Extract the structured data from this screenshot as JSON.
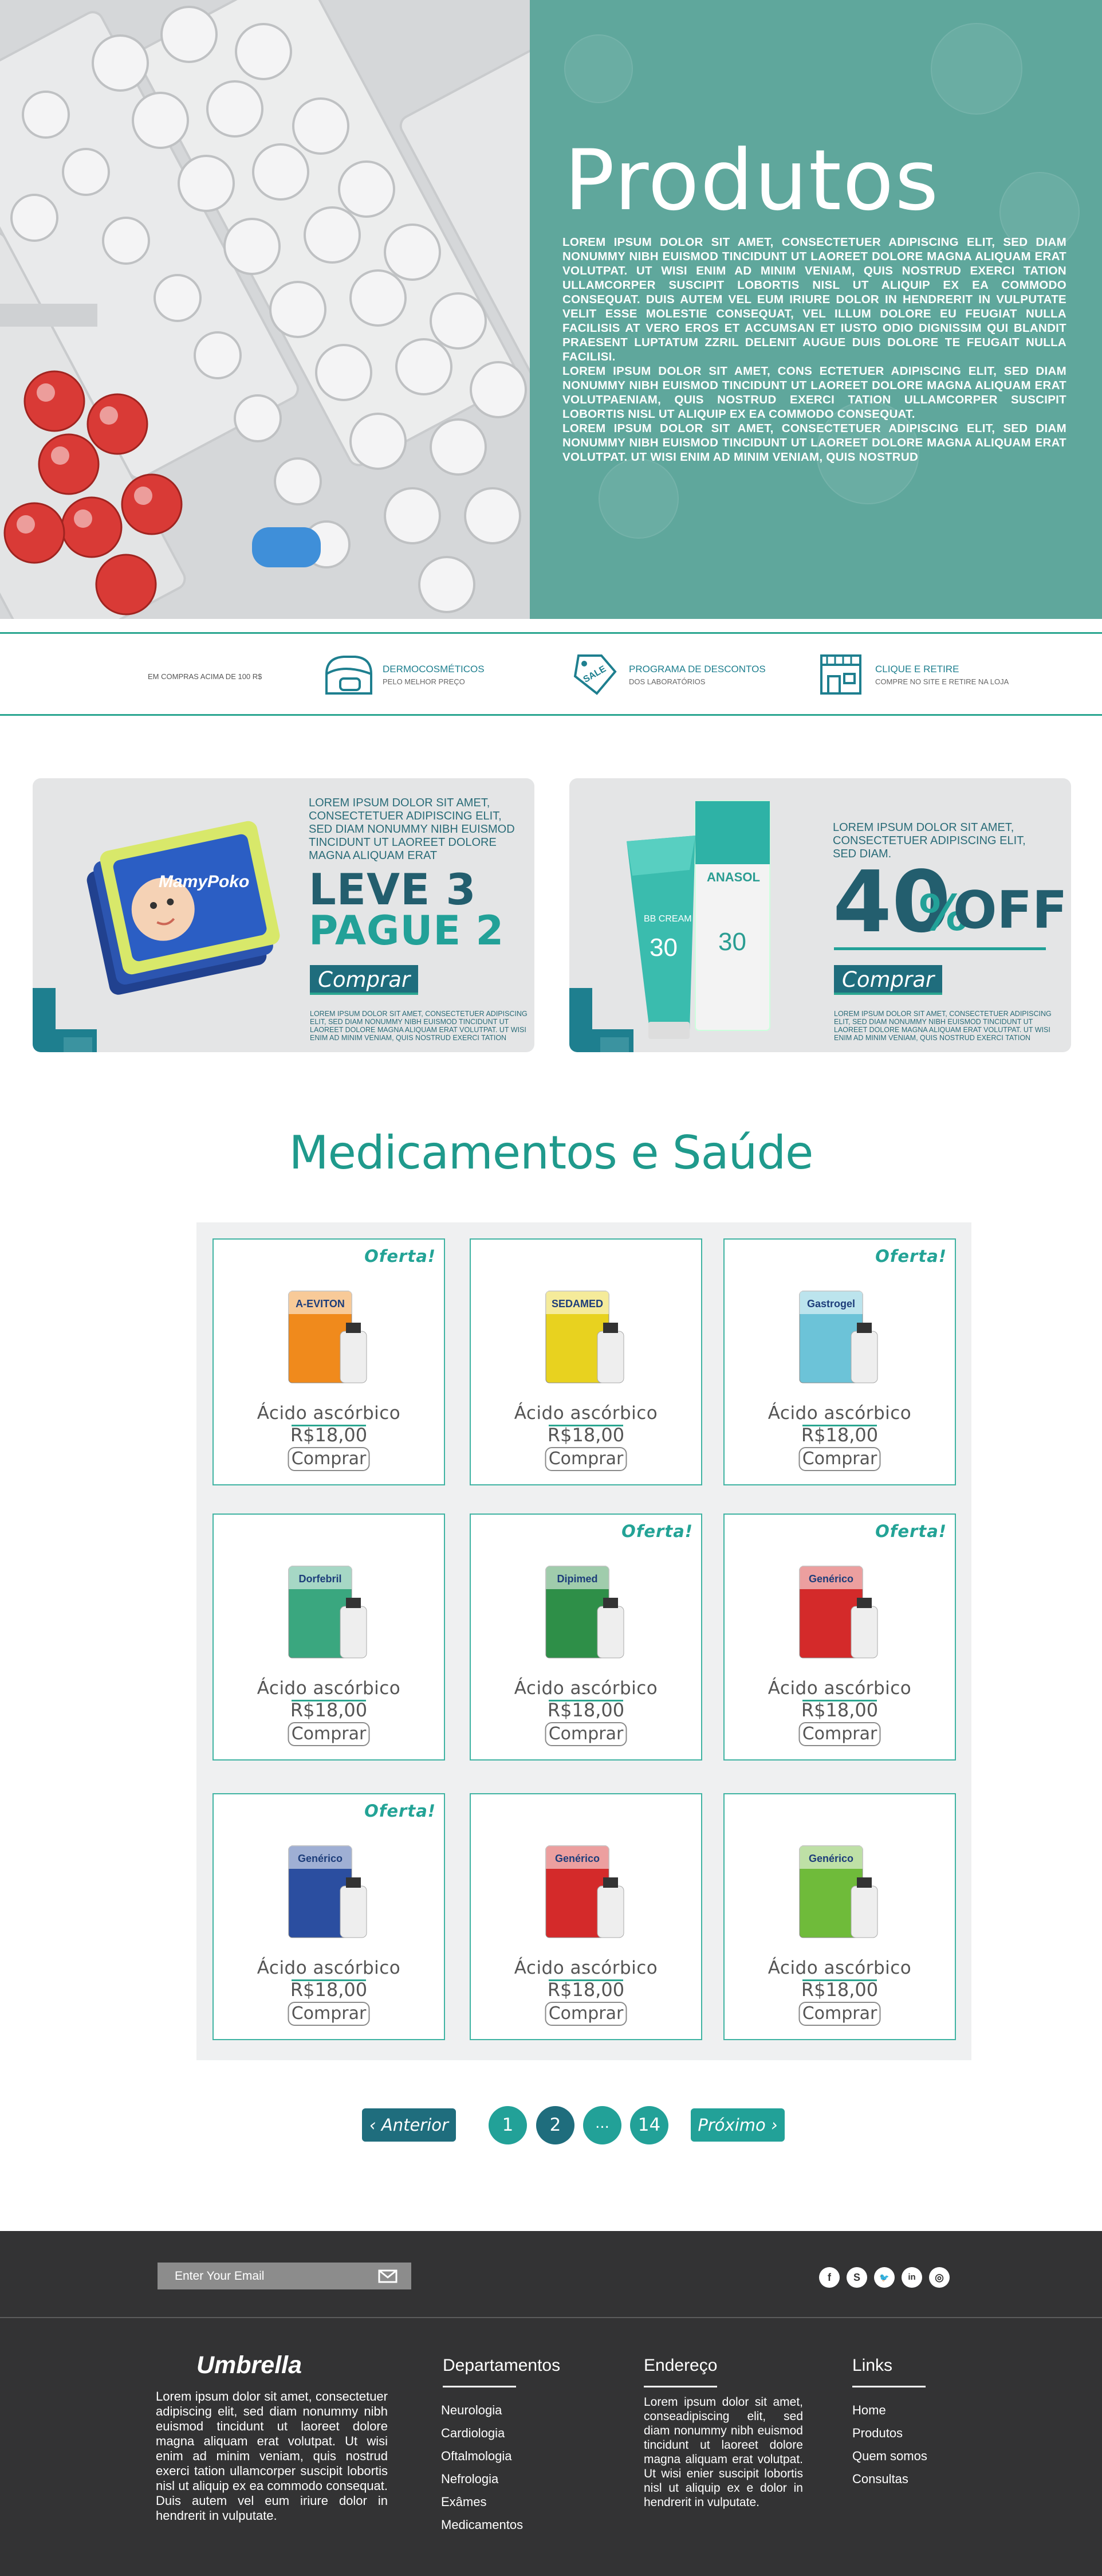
{
  "hero": {
    "title": "Produtos",
    "paragraphs": [
      "Lorem ipsum dolor sit amet, consectetuer adipiscing elit, sed diam nonummy nibh euismod tincidunt ut laoreet dolore magna aliquam erat volutpat. Ut wisi enim ad minim veniam, quis nostrud exerci tation ullamcorper suscipit lobortis nisl ut aliquip ex ea commodo consequat. Duis autem vel eum iriure dolor in hendrerit in vulputate velit esse molestie consequat, vel illum dolore eu feugiat nulla facilisis at vero eros et accumsan et iusto odio dignissim qui blandit praesent luptatum zzril delenit augue duis dolore te feugait nulla facilisi.",
      "Lorem ipsum dolor sit amet, cons ectetuer adipiscing elit, sed diam nonummy nibh euismod tincidunt ut laoreet dolore magna aliquam erat volutpaeniam, quis nostrud exerci tation ullamcorper suscipit lobortis nisl ut aliquip ex ea commodo consequat.",
      "Lorem ipsum dolor sit amet, consectetuer adipiscing elit, sed diam nonummy nibh euismod tincidunt ut laoreet dolore magna aliquam erat volutpat. Ut wisi enim ad minim veniam, quis nostrud"
    ]
  },
  "features": {
    "left_text": "Em compras acima de 100 R$",
    "items": [
      {
        "title": "Dermocosméticos",
        "subtitle": "Pelo melhor preço",
        "icon": "cosmetics-icon"
      },
      {
        "title": "Programa de descontos",
        "subtitle": "dos laboratórios",
        "icon": "sale-tag-icon"
      },
      {
        "title": "Clique e retire",
        "subtitle": "Compre no site e retire na loja",
        "icon": "store-icon"
      }
    ]
  },
  "promo1": {
    "text": "Lorem ipsum dolor sit amet, consectetuer adipiscing elit, sed diam nonummy nibh euismod tincidunt ut laoreet dolore magna aliquam erat",
    "headline1": "LEVE 3",
    "headline2": "PAGUE 2",
    "button": "Comprar",
    "small": "Lorem ipsum dolor sit amet, consectetuer adipiscing elit, sed diam nonummy nibh euismod tincidunt ut laoreet dolore magna aliquam erat volutpat. Ut wisi enim ad minim veniam, quis nostrud exerci tation",
    "product_label": "MamyPoko"
  },
  "promo2": {
    "text": "Lorem ipsum dolor sit amet, consectetuer adipiscing elit, sed diam.",
    "number": "40",
    "pct": "%",
    "word": "OFF",
    "button": "Comprar",
    "small": "Lorem ipsum dolor sit amet, consectetuer adipiscing elit, sed diam nonummy nibh euismod tincidunt ut laoreet dolore magna aliquam erat volutpat. Ut wisi enim ad minim veniam, quis nostrud exerci tation",
    "product_label": "ANASOL",
    "product_sub": "BB CREAM",
    "spf": "30"
  },
  "section_title": "Medicamentos e Saúde",
  "offer_label": "Oferta!",
  "products": [
    {
      "name": "Ácido ascórbico",
      "price": "R$18,00",
      "button": "Comprar",
      "offer": true,
      "brand": "A-EVITON",
      "color": "#f08a1c"
    },
    {
      "name": "Ácido ascórbico",
      "price": "R$18,00",
      "button": "Comprar",
      "offer": false,
      "brand": "SEDAMED",
      "color": "#e8d21f"
    },
    {
      "name": "Ácido ascórbico",
      "price": "R$18,00",
      "button": "Comprar",
      "offer": true,
      "brand": "Gastrogel",
      "color": "#6cc3d8"
    },
    {
      "name": "Ácido ascórbico",
      "price": "R$18,00",
      "button": "Comprar",
      "offer": false,
      "brand": "Dorfebril",
      "color": "#3aa77f"
    },
    {
      "name": "Ácido ascórbico",
      "price": "R$18,00",
      "button": "Comprar",
      "offer": true,
      "brand": "Dipimed",
      "color": "#2e8f48"
    },
    {
      "name": "Ácido ascórbico",
      "price": "R$18,00",
      "button": "Comprar",
      "offer": true,
      "brand": "Genérico",
      "color": "#d42a2a"
    },
    {
      "name": "Ácido ascórbico",
      "price": "R$18,00",
      "button": "Comprar",
      "offer": true,
      "brand": "Genérico",
      "color": "#2b4ea0"
    },
    {
      "name": "Ácido ascórbico",
      "price": "R$18,00",
      "button": "Comprar",
      "offer": false,
      "brand": "Genérico",
      "color": "#d42a2a"
    },
    {
      "name": "Ácido ascórbico",
      "price": "R$18,00",
      "button": "Comprar",
      "offer": false,
      "brand": "Genérico",
      "color": "#6fbb3a"
    }
  ],
  "pagination": {
    "prev": "Anterior",
    "next": "Próximo",
    "pages": [
      "1",
      "2",
      "...",
      "14"
    ],
    "active": "2"
  },
  "footer": {
    "email_placeholder": "Enter Your Email",
    "social": [
      "facebook-icon",
      "skype-icon",
      "twitter-icon",
      "linkedin-icon",
      "instagram-icon"
    ],
    "brand": "Umbrella",
    "about": "Lorem ipsum dolor sit amet, consectetuer adipiscing elit, sed diam nonummy nibh euismod tincidunt ut laoreet dolore magna aliquam erat volutpat. Ut wisi enim ad minim veniam, quis nostrud exerci tation ullamcorper suscipit lobortis nisl ut aliquip ex ea commodo consequat. Duis autem vel eum iriure dolor in hendrerit in vulputate.",
    "departments_title": "Departamentos",
    "departments": [
      "Neurologia",
      "Cardiologia",
      "Oftalmologia",
      "Nefrologia",
      "Exâmes",
      "Medicamentos"
    ],
    "address_title": "Endereço",
    "address_text": "Lorem ipsum dolor sit amet, conseadipiscing elit, sed diam nonummy nibh euismod tincidunt ut laoreet dolore magna aliquam erat volutpat. Ut wisi enier suscipit lobortis nisl ut aliquip ex e dolor in hendrerit in vulputate.",
    "links_title": "Links",
    "links": [
      "Home",
      "Produtos",
      "Quem somos",
      "Consultas"
    ]
  }
}
